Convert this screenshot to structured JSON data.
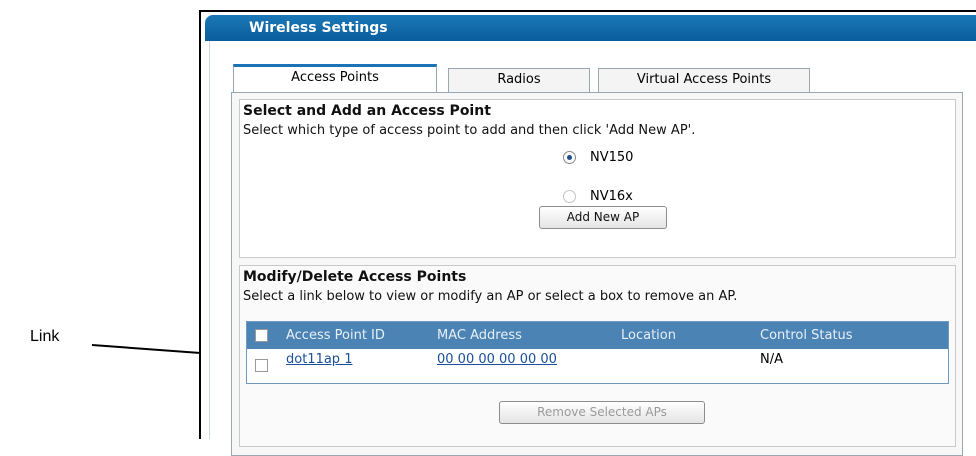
{
  "callout": {
    "label": "Link"
  },
  "window": {
    "title": "Wireless Settings"
  },
  "tabs": [
    {
      "label": "Access Points",
      "active": true
    },
    {
      "label": "Radios",
      "active": false
    },
    {
      "label": "Virtual Access Points",
      "active": false
    }
  ],
  "add_section": {
    "title": "Select and Add an Access Point",
    "description": "Select which type of access point to add and then click 'Add New AP'.",
    "options": [
      {
        "label": "NV150",
        "selected": true
      },
      {
        "label": "NV16x",
        "selected": false
      }
    ],
    "add_button": "Add New AP"
  },
  "modify_section": {
    "title": "Modify/Delete Access Points",
    "description": "Select a link below to view or modify an AP or select a box to remove an AP.",
    "columns": [
      "Access Point ID",
      "MAC Address",
      "Location",
      "Control Status"
    ],
    "rows": [
      {
        "ap_id": "dot11ap 1",
        "mac": "00 00 00 00 00 00",
        "location": "",
        "status": "N/A"
      }
    ],
    "remove_button": "Remove Selected APs"
  },
  "colors": {
    "accent": "#1a73b5",
    "header": "#4a83b4",
    "link": "#1a4f9c"
  }
}
